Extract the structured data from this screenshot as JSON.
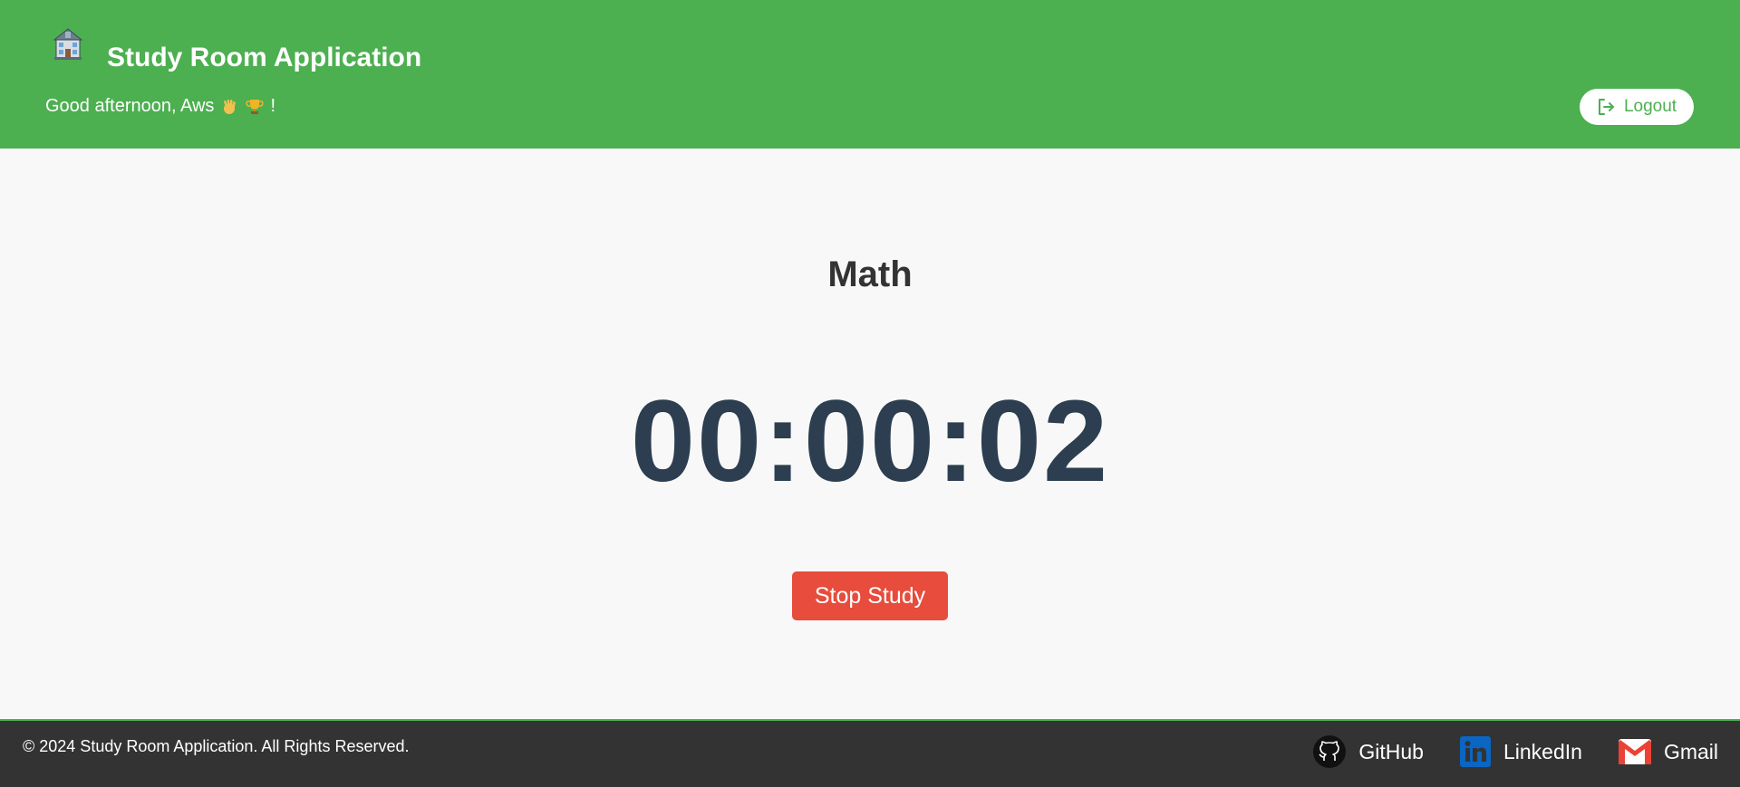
{
  "header": {
    "logo_icon": "school-building-icon",
    "title": "Study Room Application",
    "greeting_text": "Good afternoon, Aws",
    "greeting_emojis": [
      "waving-hand-icon",
      "trophy-icon"
    ],
    "greeting_suffix": "!",
    "logout_label": "Logout",
    "logout_icon": "logout-icon"
  },
  "main": {
    "subject": "Math",
    "timer": "00:00:02",
    "stop_label": "Stop Study"
  },
  "footer": {
    "copyright": "© 2024 Study Room Application. All Rights Reserved.",
    "links": [
      {
        "label": "GitHub",
        "icon": "github-icon"
      },
      {
        "label": "LinkedIn",
        "icon": "linkedin-icon"
      },
      {
        "label": "Gmail",
        "icon": "gmail-icon"
      }
    ]
  },
  "colors": {
    "header_bg": "#4caf50",
    "footer_bg": "#333333",
    "stop_button": "#e74c3c",
    "timer_text": "#2c3e50",
    "page_bg": "#f8f8f8"
  }
}
